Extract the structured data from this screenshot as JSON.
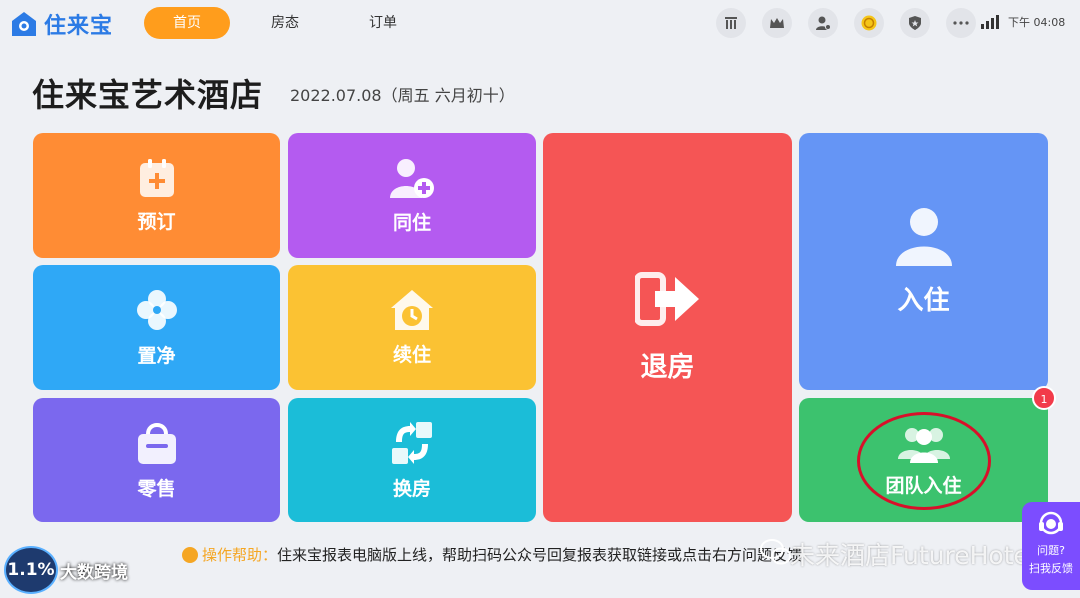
{
  "app": {
    "name": "住来宝"
  },
  "nav": {
    "tabs": [
      {
        "label": "首页",
        "active": true
      },
      {
        "label": "房态"
      },
      {
        "label": "订单"
      }
    ]
  },
  "status": {
    "time": "下午 04:08"
  },
  "top_icons": [
    "stats-icon",
    "crown-icon",
    "user-settings-icon",
    "coin-icon",
    "shield-icon",
    "more-icon"
  ],
  "header": {
    "hotel_name": "住来宝艺术酒店",
    "date": "2022.07.08（周五 六月初十）"
  },
  "tiles": {
    "reserve": {
      "label": "预订"
    },
    "cohabit": {
      "label": "同住"
    },
    "checkout": {
      "label": "退房"
    },
    "checkin": {
      "label": "入住"
    },
    "clean": {
      "label": "置净"
    },
    "extend": {
      "label": "续住"
    },
    "retail": {
      "label": "零售"
    },
    "change_room": {
      "label": "换房"
    },
    "group_checkin": {
      "label": "团队入住",
      "badge": "1"
    }
  },
  "help": {
    "title": "操作帮助：",
    "text": "住来宝报表电脑版上线，帮助扫码公众号回复报表获取链接或点击右方问题反馈"
  },
  "feedback": {
    "question": "问题?",
    "label": "扫我反馈"
  },
  "watermarks": {
    "right": "未来酒店FutureHotel",
    "left_badge": "1.1%",
    "left_text": "大数跨境"
  },
  "colors": {
    "accent": "#ff9d1c",
    "reserve": "#ff8c34",
    "cohabit": "#b45bf0",
    "checkout": "#f55555",
    "checkin": "#6595f5",
    "clean": "#2fa8f6",
    "extend": "#fbc233",
    "retail": "#7b68ee",
    "change_room": "#1bbdd8",
    "group_checkin": "#3cc26e",
    "feedback": "#7c4dff"
  }
}
